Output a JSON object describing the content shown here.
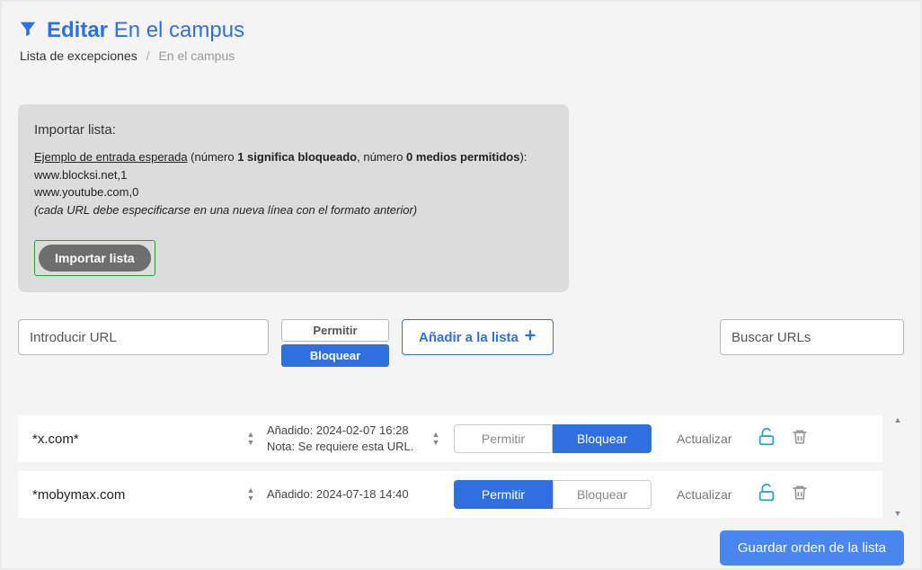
{
  "header": {
    "title_bold": "Editar",
    "title_normal": "En el campus"
  },
  "breadcrumb": {
    "root": "Lista de excepciones",
    "current": "En el campus"
  },
  "import_panel": {
    "title": "Importar lista:",
    "example_label": "Ejemplo de entrada esperada",
    "example_desc_pre": " (número ",
    "example_desc_b1": "1 significa bloqueado",
    "example_desc_mid": ", número ",
    "example_desc_b2": "0 medios permitidos",
    "example_desc_post": "):",
    "line1": "www.blocksi.net,1",
    "line2": "www.youtube.com,0",
    "note": "(cada URL debe especificarse en una nueva línea con el formato anterior)",
    "btn": "Importar lista"
  },
  "controls": {
    "url_placeholder": "Introducir URL",
    "toggle_permit": "Permitir",
    "toggle_block": "Bloquear",
    "add_label": "Añadir a la lista",
    "search_placeholder": "Buscar URLs"
  },
  "rows": [
    {
      "url": "*x.com*",
      "added_label": "Añadido: 2024-02-07 16:28",
      "note_label": "Nota: Se requiere esta URL.",
      "permit": "Permitir",
      "block": "Bloquear",
      "blocked": true,
      "update": "Actualizar"
    },
    {
      "url": "*mobymax.com",
      "added_label": "Añadido: 2024-07-18 14:40",
      "note_label": "",
      "permit": "Permitir",
      "block": "Bloquear",
      "blocked": false,
      "update": "Actualizar"
    }
  ],
  "footer": {
    "save": "Guardar orden de la lista"
  },
  "colors": {
    "primary": "#2f6fe0",
    "teal": "#2aa7c8",
    "gray": "#999"
  }
}
